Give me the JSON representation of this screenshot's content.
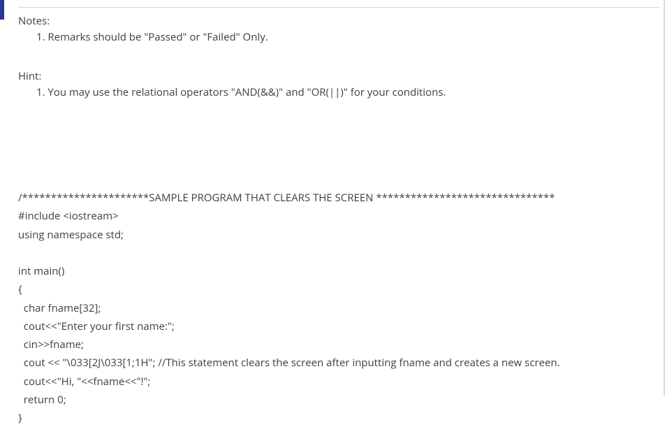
{
  "notes": {
    "label": "Notes:",
    "item1": "1. Remarks should be \"Passed\" or \"Failed\" Only."
  },
  "hint": {
    "label": "Hint:",
    "item1": "1. You may use the relational operators \"AND(&&)\" and \"OR(||)\" for your conditions."
  },
  "code": {
    "line1": "/**********************SAMPLE PROGRAM THAT CLEARS THE SCREEN *******************************",
    "line2": "#include <iostream>",
    "line3": "using namespace std;",
    "line4": "",
    "line5": "int main()",
    "line6": "{",
    "line7": "  char fname[32];",
    "line8": "  cout<<\"Enter your first name:\";",
    "line9": "  cin>>fname;",
    "line10": "  cout << \"\\033[2J\\033[1;1H\"; //This statement clears the screen after inputting fname and creates a new screen.",
    "line11": "  cout<<\"Hi, \"<<fname<<\"!\";",
    "line12": "  return 0;",
    "line13": "}"
  }
}
